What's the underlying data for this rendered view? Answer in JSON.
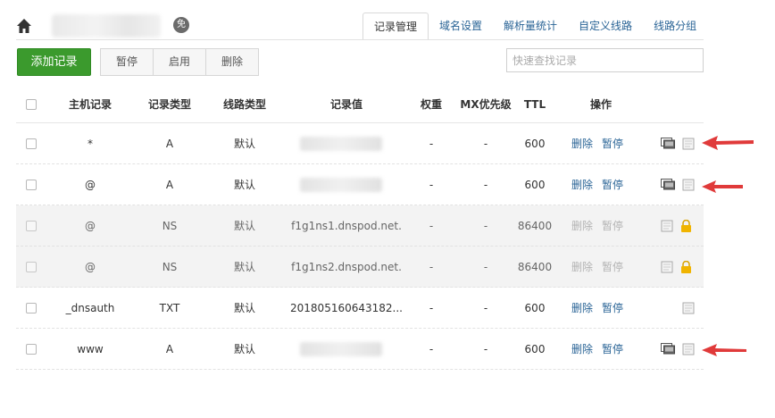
{
  "header": {
    "free_badge": "免"
  },
  "tabs": [
    {
      "label": "记录管理",
      "active": true
    },
    {
      "label": "域名设置",
      "active": false
    },
    {
      "label": "解析量统计",
      "active": false
    },
    {
      "label": "自定义线路",
      "active": false
    },
    {
      "label": "线路分组",
      "active": false
    }
  ],
  "toolbar": {
    "add_label": "添加记录",
    "pause_label": "暂停",
    "enable_label": "启用",
    "delete_label": "删除",
    "search_placeholder": "快速查找记录"
  },
  "table": {
    "columns": [
      "主机记录",
      "记录类型",
      "线路类型",
      "记录值",
      "权重",
      "MX优先级",
      "TTL",
      "操作"
    ],
    "rows": [
      {
        "host": "*",
        "type": "A",
        "line": "默认",
        "value": "",
        "weight": "-",
        "mx": "-",
        "ttl": "600",
        "op_delete": "删除",
        "op_pause": "暂停"
      },
      {
        "host": "@",
        "type": "A",
        "line": "默认",
        "value": "",
        "weight": "-",
        "mx": "-",
        "ttl": "600",
        "op_delete": "删除",
        "op_pause": "暂停"
      },
      {
        "host": "@",
        "type": "NS",
        "line": "默认",
        "value": "f1g1ns1.dnspod.net.",
        "weight": "-",
        "mx": "-",
        "ttl": "86400",
        "op_delete": "删除",
        "op_pause": "暂停"
      },
      {
        "host": "@",
        "type": "NS",
        "line": "默认",
        "value": "f1g1ns2.dnspod.net.",
        "weight": "-",
        "mx": "-",
        "ttl": "86400",
        "op_delete": "删除",
        "op_pause": "暂停"
      },
      {
        "host": "_dnsauth",
        "type": "TXT",
        "line": "默认",
        "value": "201805160643182...",
        "weight": "-",
        "mx": "-",
        "ttl": "600",
        "op_delete": "删除",
        "op_pause": "暂停"
      },
      {
        "host": "www",
        "type": "A",
        "line": "默认",
        "value": "",
        "weight": "-",
        "mx": "-",
        "ttl": "600",
        "op_delete": "删除",
        "op_pause": "暂停"
      }
    ]
  },
  "colors": {
    "accent_green": "#3b9a2d",
    "link_blue": "#2a6496",
    "arrow_red": "#e03a3a",
    "lock_yellow": "#f0b400"
  }
}
